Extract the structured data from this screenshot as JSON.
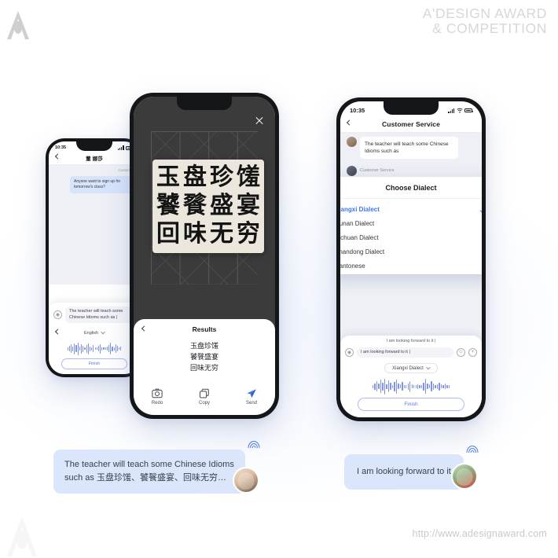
{
  "branding": {
    "award_line1": "A'DESIGN AWARD",
    "award_line2": "& COMPETITION",
    "footer_url": "http://www.adesignaward.com",
    "logo_name": "a-design-award-logo"
  },
  "phone_left": {
    "status_time": "10:35",
    "nav_title": "董 娜莎",
    "sender_label": "Customer",
    "message": "Anyone want to sign up for tomorrow's class?",
    "input_value": "The teacher will teach some Chinese Idioms such as |",
    "dialect_label": "English",
    "finish_label": "Finish"
  },
  "phone_center": {
    "close_label": "×",
    "scanned_rows": [
      [
        "玉",
        "盘",
        "珍",
        "馐"
      ],
      [
        "饕",
        "餮",
        "盛",
        "宴"
      ],
      [
        "回",
        "味",
        "无",
        "穷"
      ]
    ],
    "results_title": "Results",
    "result_lines": [
      "玉盘珍馐",
      "饕餮盛宴",
      "回味无穷"
    ],
    "actions": [
      {
        "label": "Redo",
        "icon": "camera-icon"
      },
      {
        "label": "Copy",
        "icon": "copy-icon"
      },
      {
        "label": "Send",
        "icon": "send-icon"
      }
    ]
  },
  "phone_right": {
    "status_time": "10:35",
    "nav_title": "Customer Service",
    "message": "The teacher will teach some Chinese Idioms such as",
    "sender_label": "Customer Service",
    "dialect_panel": {
      "title": "Choose Dialect",
      "options": [
        {
          "label": "Xiangxi Dialect",
          "selected": true
        },
        {
          "label": "Hunan Dialect",
          "selected": false
        },
        {
          "label": "Sichuan Dialect",
          "selected": false
        },
        {
          "label": "Shandong Dialect",
          "selected": false
        },
        {
          "label": "Cantonese",
          "selected": false
        }
      ]
    },
    "draft_text": "I am looking forward to it |",
    "input_value": "I am looking forward to it |",
    "dialect_label": "Xiangxi Dialect",
    "finish_label": "Finish"
  },
  "float_messages": {
    "left": {
      "line1": "The teacher will teach some Chinese Idioms",
      "line2": "such as 玉盘珍馐、饕餮盛宴、回味无穷…"
    },
    "right": {
      "text": "I am looking forward to it"
    }
  },
  "colors": {
    "accent_blue": "#3a78f2",
    "bubble_blue": "#dbe5fb",
    "wave_blue": "#7f93e8",
    "dark_frame": "#14161a"
  }
}
